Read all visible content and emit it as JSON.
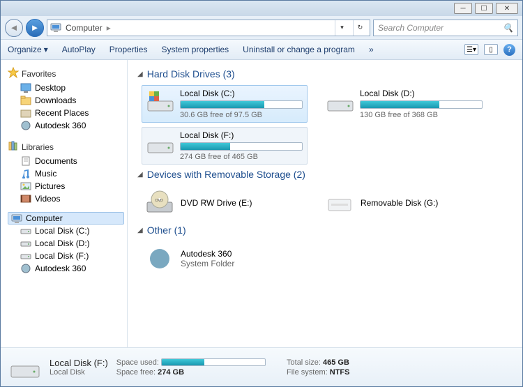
{
  "titlebar": {},
  "nav": {
    "crumb": "Computer",
    "search_placeholder": "Search Computer"
  },
  "toolbar": {
    "organize": "Organize",
    "autoplay": "AutoPlay",
    "properties": "Properties",
    "system_properties": "System properties",
    "uninstall": "Uninstall or change a program",
    "more": "»"
  },
  "sidebar": {
    "favorites": {
      "label": "Favorites",
      "items": [
        "Desktop",
        "Downloads",
        "Recent Places",
        "Autodesk 360"
      ]
    },
    "libraries": {
      "label": "Libraries",
      "items": [
        "Documents",
        "Music",
        "Pictures",
        "Videos"
      ]
    },
    "computer": {
      "label": "Computer",
      "items": [
        "Local Disk (C:)",
        "Local Disk (D:)",
        "Local Disk (F:)",
        "Autodesk 360"
      ]
    }
  },
  "categories": {
    "hdd": {
      "title": "Hard Disk Drives (3)",
      "drives": [
        {
          "name": "Local Disk (C:)",
          "free_text": "30.6 GB free of 97.5 GB",
          "used_pct": 69
        },
        {
          "name": "Local Disk (D:)",
          "free_text": "130 GB free of 368 GB",
          "used_pct": 65
        },
        {
          "name": "Local Disk (F:)",
          "free_text": "274 GB free of 465 GB",
          "used_pct": 41
        }
      ]
    },
    "removable": {
      "title": "Devices with Removable Storage (2)",
      "items": [
        {
          "name": "DVD RW Drive (E:)"
        },
        {
          "name": "Removable Disk (G:)"
        }
      ]
    },
    "other": {
      "title": "Other (1)",
      "items": [
        {
          "name": "Autodesk 360",
          "sub": "System Folder"
        }
      ]
    }
  },
  "details": {
    "title": "Local Disk (F:)",
    "type": "Local Disk",
    "space_used_label": "Space used:",
    "space_used_pct": 41,
    "space_free_label": "Space free:",
    "space_free": "274 GB",
    "total_size_label": "Total size:",
    "total_size": "465 GB",
    "fs_label": "File system:",
    "fs": "NTFS"
  }
}
